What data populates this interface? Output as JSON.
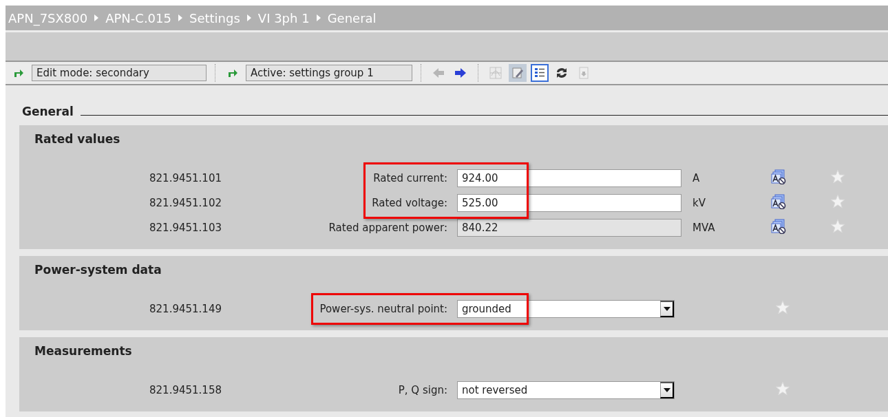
{
  "breadcrumb": [
    "APN_7SX800",
    "APN-C.015",
    "Settings",
    "VI 3ph 1",
    "General"
  ],
  "toolbar": {
    "edit_mode": "Edit mode:  secondary",
    "active_group": "Active:  settings group 1",
    "buttons": [
      {
        "kind": "back",
        "disabled": true,
        "selected": false
      },
      {
        "kind": "forward",
        "disabled": false,
        "selected": false
      },
      {
        "kind": "chart",
        "disabled": true,
        "selected": false
      },
      {
        "kind": "edit",
        "disabled": false,
        "selected": true
      },
      {
        "kind": "list",
        "disabled": false,
        "selected": true
      },
      {
        "kind": "refresh",
        "disabled": false,
        "selected": false
      },
      {
        "kind": "download",
        "disabled": true,
        "selected": false
      }
    ]
  },
  "page_title": "General",
  "sections": [
    {
      "title": "Rated values",
      "rows": [
        {
          "id": "821.9451.101",
          "label": "Rated current:",
          "kind": "input",
          "value": "924.00",
          "unit": "A",
          "highlighted": true
        },
        {
          "id": "821.9451.102",
          "label": "Rated voltage:",
          "kind": "input",
          "value": "525.00",
          "unit": "kV",
          "highlighted": true
        },
        {
          "id": "821.9451.103",
          "label": "Rated apparent power:",
          "kind": "readonly",
          "value": "840.22",
          "unit": "MVA",
          "highlighted": false
        }
      ]
    },
    {
      "title": "Power-system data",
      "rows": [
        {
          "id": "821.9451.149",
          "label": "Power-sys. neutral point:",
          "kind": "dropdown",
          "value": "grounded",
          "highlighted": true
        }
      ]
    },
    {
      "title": "Measurements",
      "rows": [
        {
          "id": "821.9451.158",
          "label": "P, Q sign:",
          "kind": "dropdown",
          "value": "not reversed",
          "highlighted": false
        }
      ]
    }
  ]
}
